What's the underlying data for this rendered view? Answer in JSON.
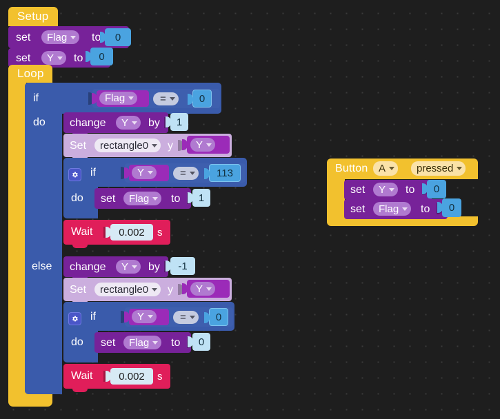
{
  "workspace": {
    "background": "#1e1e1e",
    "grid_dot_color": "#3a3a3a"
  },
  "palette": {
    "hat_yellow": "#f2c12e",
    "variable_purple": "#772299",
    "sprite_lpurple": "#cbaede",
    "control_blue": "#3a5bab",
    "wait_crimson": "#e01e5a",
    "number_blue": "#4aa3e0",
    "reporter_violet": "#9b2bb8",
    "compare_grey": "#8f9bc4"
  },
  "stacks": {
    "setup": {
      "hat_label": "Setup",
      "statements": [
        {
          "kind": "set-variable",
          "set_label": "set",
          "variable": "Flag",
          "to_label": "to",
          "value": "0"
        },
        {
          "kind": "set-variable",
          "set_label": "set",
          "variable": "Y",
          "to_label": "to",
          "value": "0"
        }
      ]
    },
    "loop": {
      "hat_label": "Loop",
      "if_block": {
        "if_label": "if",
        "do_label": "do",
        "else_label": "else",
        "condition": {
          "left_variable": "Flag",
          "operator": "=",
          "right_value": "0"
        },
        "do_branch": [
          {
            "kind": "change-variable",
            "change_label": "change",
            "variable": "Y",
            "by_label": "by",
            "value": "1"
          },
          {
            "kind": "set-sprite-property",
            "set_label": "Set",
            "object": "rectangle0",
            "property_label": "y",
            "value_variable": "Y"
          },
          {
            "kind": "if",
            "gear_icon": "gear-icon",
            "if_label": "if",
            "do_label": "do",
            "condition": {
              "left_variable": "Y",
              "operator": "=",
              "right_value": "113"
            },
            "do_branch": [
              {
                "kind": "set-variable",
                "set_label": "set",
                "variable": "Flag",
                "to_label": "to",
                "value": "1"
              }
            ]
          },
          {
            "kind": "wait",
            "wait_label": "Wait",
            "value": "0.002",
            "unit_label": "s"
          }
        ],
        "else_branch": [
          {
            "kind": "change-variable",
            "change_label": "change",
            "variable": "Y",
            "by_label": "by",
            "value": "-1"
          },
          {
            "kind": "set-sprite-property",
            "set_label": "Set",
            "object": "rectangle0",
            "property_label": "y",
            "value_variable": "Y"
          },
          {
            "kind": "if",
            "gear_icon": "gear-icon",
            "if_label": "if",
            "do_label": "do",
            "condition": {
              "left_variable": "Y",
              "operator": "=",
              "right_value": "0"
            },
            "do_branch": [
              {
                "kind": "set-variable",
                "set_label": "set",
                "variable": "Flag",
                "to_label": "to",
                "value": "0"
              }
            ]
          },
          {
            "kind": "wait",
            "wait_label": "Wait",
            "value": "0.002",
            "unit_label": "s"
          }
        ]
      }
    },
    "button_event": {
      "hat_label": "Button",
      "button_name": "A",
      "event_name": "pressed",
      "statements": [
        {
          "kind": "set-variable",
          "set_label": "set",
          "variable": "Y",
          "to_label": "to",
          "value": "0"
        },
        {
          "kind": "set-variable",
          "set_label": "set",
          "variable": "Flag",
          "to_label": "to",
          "value": "0"
        }
      ]
    }
  }
}
